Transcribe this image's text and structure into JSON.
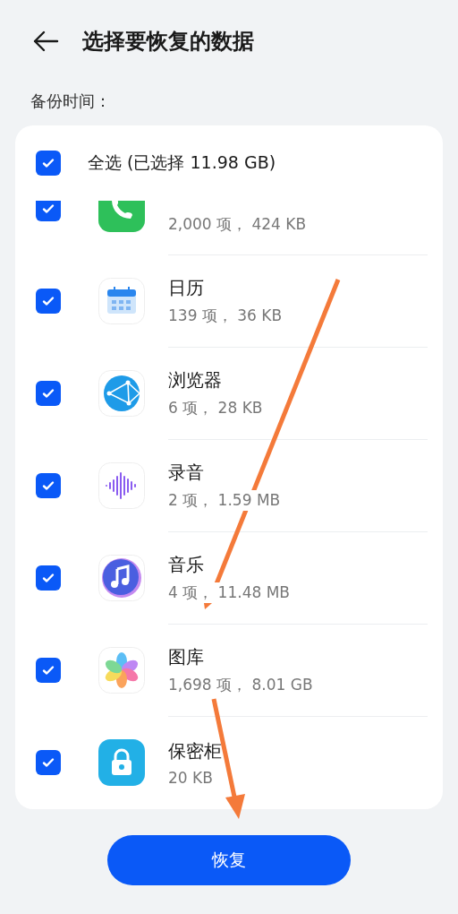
{
  "header": {
    "title": "选择要恢复的数据"
  },
  "backup_time": {
    "label": "备份时间："
  },
  "select_all": {
    "label": "全选 (已选择 11.98 GB)",
    "checked": true
  },
  "items": [
    {
      "detail": "2,000 项， 424 KB",
      "checked": true
    },
    {
      "name": "日历",
      "detail": "139 项， 36 KB",
      "checked": true
    },
    {
      "name": "浏览器",
      "detail": "6 项， 28 KB",
      "checked": true
    },
    {
      "name": "录音",
      "detail": "2 项， 1.59 MB",
      "checked": true
    },
    {
      "name": "音乐",
      "detail": "4 项， 11.48 MB",
      "checked": true
    },
    {
      "name": "图库",
      "detail": "1,698 项， 8.01 GB",
      "checked": true
    },
    {
      "name": "保密柜",
      "detail": "20 KB",
      "checked": true
    }
  ],
  "restore_button": {
    "label": "恢复"
  }
}
